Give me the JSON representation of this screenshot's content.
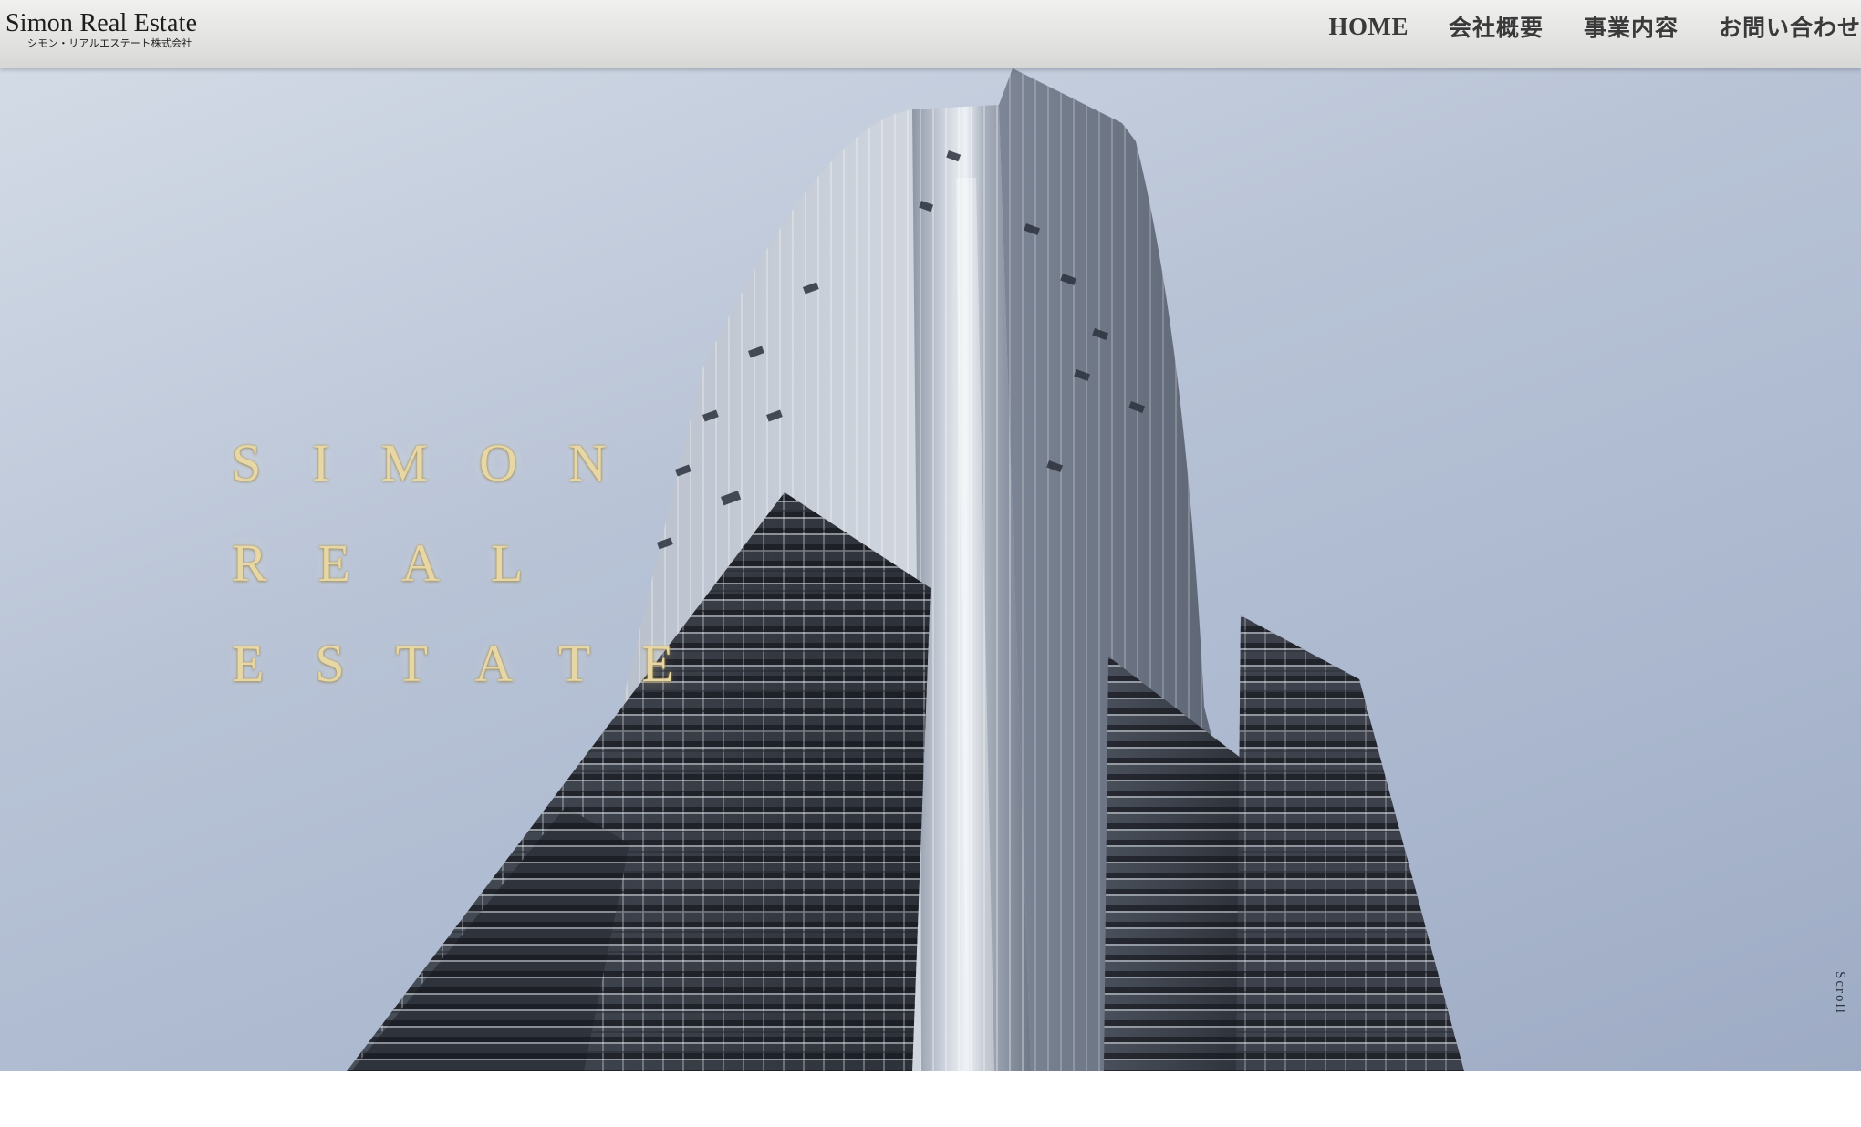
{
  "header": {
    "brand_title": "Simon Real Estate",
    "brand_subtitle": "シモン・リアルエステート株式会社",
    "nav": [
      {
        "label": "HOME"
      },
      {
        "label": "会社概要"
      },
      {
        "label": "事業内容"
      },
      {
        "label": "お問い合わせ"
      }
    ]
  },
  "hero": {
    "title_lines": [
      "SIMON",
      "REAL",
      "ESTATE"
    ],
    "scroll_label": "Scroll",
    "title_color": "#e7d7a4",
    "sky_color": "#b8c3d6"
  }
}
